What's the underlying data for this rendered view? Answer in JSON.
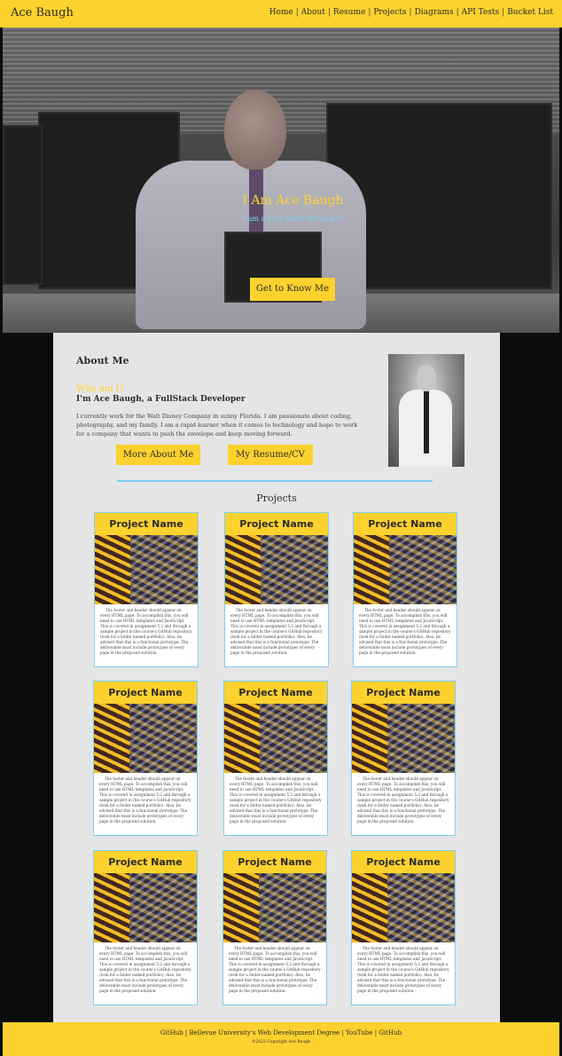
{
  "header": {
    "brand": "Ace Baugh",
    "nav": [
      "Home",
      "About",
      "Resume",
      "Projects",
      "Diagrams",
      "API Tests",
      "Bucket List"
    ]
  },
  "hero": {
    "title": "I Am Ace Baugh",
    "subtitle": "I am a Full-Stack Developer",
    "button": "Get to Know Me"
  },
  "about": {
    "heading": "About Me",
    "who": "Who am I?",
    "who_sub": "I'm Ace Baugh, a FullStack Developer",
    "bio": "I currently work for the Walt Disney Company in sunny Florida. I am passionate about coding, photography, and my family. I am a rapid learner when it comes to technology and hope to work for a company that wants to push the envelope and keep moving forward.",
    "more_button": "More About Me",
    "resume_button": "My Resume/CV"
  },
  "projects": {
    "heading": "Projects",
    "cards": [
      {
        "title": "Project Name",
        "text": "The footer and header should appear on every HTML page. To accomplish this, you will need to use HTML templates and JavaScript. This is covered in assignment 5.2 and through a sample project in the course's GitHub repository (look for a folder named portfolio). Also, be advised that this is a functional prototype. The deliverable must include prototypes of every page in the proposed solution."
      },
      {
        "title": "Project Name",
        "text": "The footer and header should appear on every HTML page. To accomplish this, you will need to use HTML templates and JavaScript. This is covered in assignment 5.2 and through a sample project in the course's GitHub repository (look for a folder named portfolio). Also, be advised that this is a functional prototype. The deliverable must include prototypes of every page in the proposed solution."
      },
      {
        "title": "Project Name",
        "text": "The footer and header should appear on every HTML page. To accomplish this, you will need to use HTML templates and JavaScript. This is covered in assignment 5.2 and through a sample project in the course's GitHub repository (look for a folder named portfolio). Also, be advised that this is a functional prototype. The deliverable must include prototypes of every page in the proposed solution."
      },
      {
        "title": "Project Name",
        "text": "The footer and header should appear on every HTML page. To accomplish this, you will need to use HTML templates and JavaScript. This is covered in assignment 5.2 and through a sample project in the course's GitHub repository (look for a folder named portfolio). Also, be advised that this is a functional prototype. The deliverable must include prototypes of every page in the proposed solution."
      },
      {
        "title": "Project Name",
        "text": "The footer and header should appear on every HTML page. To accomplish this, you will need to use HTML templates and JavaScript. This is covered in assignment 5.2 and through a sample project in the course's GitHub repository (look for a folder named portfolio). Also, be advised that this is a functional prototype. The deliverable must include prototypes of every page in the proposed solution."
      },
      {
        "title": "Project Name",
        "text": "The footer and header should appear on every HTML page. To accomplish this, you will need to use HTML templates and JavaScript. This is covered in assignment 5.2 and through a sample project in the course's GitHub repository (look for a folder named portfolio). Also, be advised that this is a functional prototype. The deliverable must include prototypes of every page in the proposed solution."
      },
      {
        "title": "Project Name",
        "text": "The footer and header should appear on every HTML page. To accomplish this, you will need to use HTML templates and JavaScript. This is covered in assignment 5.2 and through a sample project in the course's GitHub repository (look for a folder named portfolio). Also, be advised that this is a functional prototype. The deliverable must include prototypes of every page in the proposed solution."
      },
      {
        "title": "Project Name",
        "text": "The footer and header should appear on every HTML page. To accomplish this, you will need to use HTML templates and JavaScript. This is covered in assignment 5.2 and through a sample project in the course's GitHub repository (look for a folder named portfolio). Also, be advised that this is a functional prototype. The deliverable must include prototypes of every page in the proposed solution."
      },
      {
        "title": "Project Name",
        "text": "The footer and header should appear on every HTML page. To accomplish this, you will need to use HTML templates and JavaScript. This is covered in assignment 5.2 and through a sample project in the course's GitHub repository (look for a folder named portfolio). Also, be advised that this is a functional prototype. The deliverable must include prototypes of every page in the proposed solution."
      }
    ]
  },
  "footer": {
    "links": [
      "GitHub",
      "Bellevue University's Web Development Degree",
      "YouTube",
      "GitHub"
    ],
    "copyright": "©2022 Copyright Ace Baugh"
  },
  "colors": {
    "accent": "#fdd22e",
    "link_blue": "#7fcff0",
    "panel": "#e5e5e5",
    "background": "#0b0d0c"
  }
}
